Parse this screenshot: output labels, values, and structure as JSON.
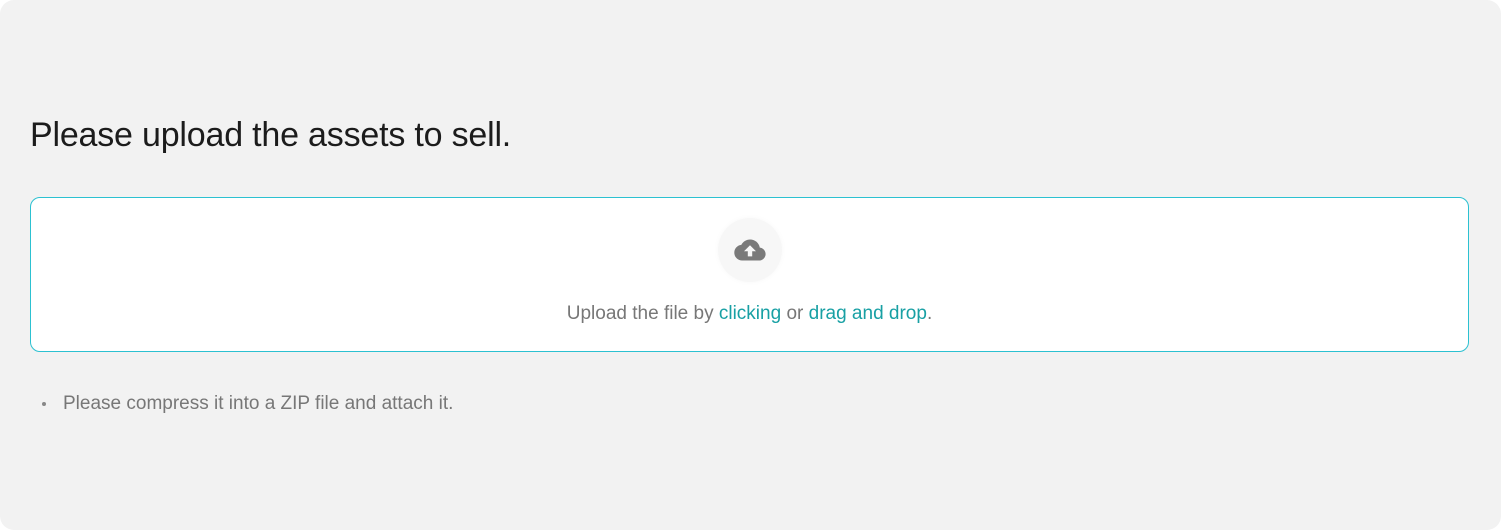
{
  "title": "Please upload the assets to sell.",
  "dropzone": {
    "icon": "cloud-upload-icon",
    "text_before": "Upload the file by ",
    "link_click": "clicking",
    "text_middle": " or ",
    "link_drag": "drag and drop",
    "text_after": "."
  },
  "notes": [
    "Please compress it into a ZIP file and attach it."
  ],
  "colors": {
    "accent": "#18a0a4",
    "border": "#2cc1d1",
    "background": "#f2f2f2"
  }
}
